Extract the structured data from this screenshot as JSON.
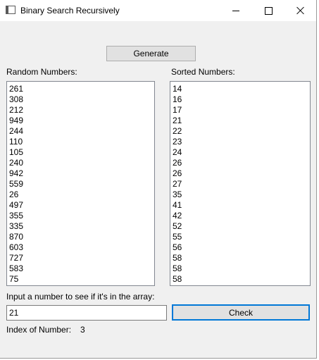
{
  "window": {
    "title": "Binary Search Recursively"
  },
  "controls": {
    "generate_label": "Generate",
    "random_label": "Random Numbers:",
    "sorted_label": "Sorted Numbers:",
    "prompt_label": "Input a number to see if it's in the array:",
    "input_value": "21",
    "check_label": "Check",
    "index_label": "Index of Number:",
    "index_value": "3"
  },
  "random_numbers": [
    "261",
    "308",
    "212",
    "949",
    "244",
    "110",
    "105",
    "240",
    "942",
    "559",
    "26",
    "497",
    "355",
    "335",
    "870",
    "603",
    "727",
    "583",
    "75"
  ],
  "sorted_numbers": [
    "14",
    "16",
    "17",
    "21",
    "22",
    "23",
    "24",
    "26",
    "26",
    "27",
    "35",
    "41",
    "42",
    "52",
    "55",
    "56",
    "58",
    "58",
    "58"
  ],
  "colors": {
    "focus_border": "#0078d7",
    "button_face": "#e1e1e1",
    "window_face": "#f0f0f0"
  }
}
